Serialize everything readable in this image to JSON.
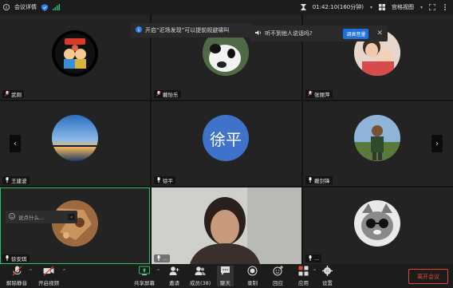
{
  "topbar": {
    "meeting_details": "会议详情",
    "timer": "01:42:10(160分钟)",
    "view_mode": "宫格视图"
  },
  "notices": {
    "nearby_tip": "开启“近场发现”可以提前规避啸叫",
    "cannot_hear": "听不到他人说话吗?",
    "raise_volume": "调高音量"
  },
  "participants": [
    {
      "name": "武刚"
    },
    {
      "name": "戴怡乐"
    },
    {
      "name": "张丽萍"
    },
    {
      "name": "王建波"
    },
    {
      "name": "徐平",
      "avatar_text": "徐平"
    },
    {
      "name": "戴剑锋"
    },
    {
      "name": "徐安琪"
    },
    {
      "name": "..."
    },
    {
      "name": "..."
    }
  ],
  "chat": {
    "placeholder": "说点什么..."
  },
  "toolbar": {
    "unmute": "解除静音",
    "start_video": "开启视频",
    "share_screen": "共享屏幕",
    "invite": "邀请",
    "members": "成员(38)",
    "chat": "聊天",
    "record": "录制",
    "reactions": "回应",
    "apps": "应用",
    "settings": "设置",
    "leave": "离开会议"
  },
  "colors": {
    "accent": "#1e6fd9",
    "danger": "#e0473b",
    "active_speaker": "#2dbf6a",
    "avatar_blue": "#3f73c9"
  }
}
